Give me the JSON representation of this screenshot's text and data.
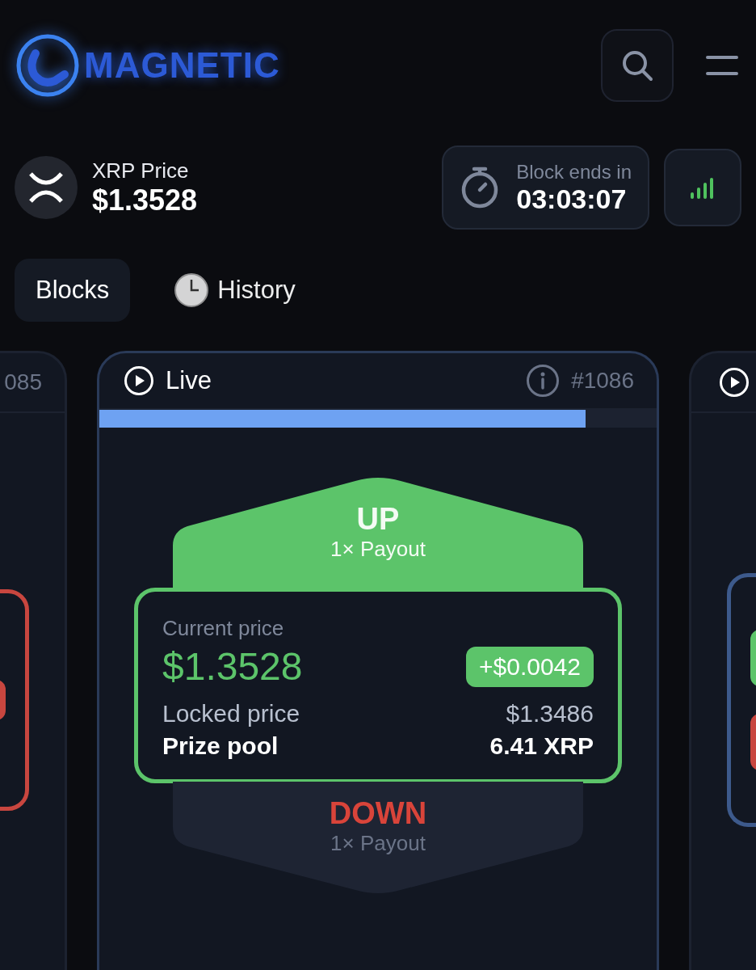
{
  "header": {
    "logo_text": "MAGNETIC"
  },
  "price": {
    "label": "XRP Price",
    "value": "$1.3528"
  },
  "timer": {
    "label": "Block ends in",
    "value": "03:03:07"
  },
  "tabs": [
    {
      "label": "Blocks",
      "selected": true,
      "kind": "plain"
    },
    {
      "label": "History",
      "selected": false,
      "kind": "clock"
    }
  ],
  "previous_card": {
    "number": "085",
    "color": "#c8463f"
  },
  "next_card": {
    "color": "#3d5a8c"
  },
  "live_card": {
    "status": "Live",
    "number": "#1086",
    "level": 0.873,
    "up": {
      "label": "UP",
      "payout": "1× Payout"
    },
    "current_label": "Current price",
    "current_value": "$1.3528",
    "change": "+$0.0042",
    "locked_label": "Locked price",
    "locked_value": "$1.3486",
    "pool_label": "Prize pool",
    "pool_value": "6.41 XRP",
    "down": {
      "label": "DOWN",
      "payout": "1× Payout"
    }
  }
}
